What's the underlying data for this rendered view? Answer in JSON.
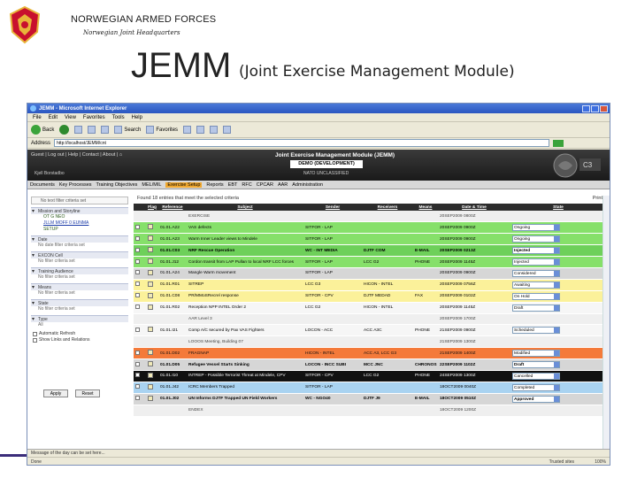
{
  "slide": {
    "org_title": "NORWEGIAN ARMED FORCES",
    "org_sub": "Norwegian Joint Headquarters",
    "title": "JEMM",
    "subtitle": "(Joint Exercise Management Module)"
  },
  "browser": {
    "window_title": "JEMM - Microsoft Internet Explorer",
    "menu": [
      "File",
      "Edit",
      "View",
      "Favorites",
      "Tools",
      "Help"
    ],
    "toolbar": {
      "back": "Back",
      "search": "Search",
      "favorites": "Favorites"
    },
    "address_label": "Address",
    "address": "http://localhost/JEMM/cnt",
    "status_message": "Message of the day can be set here...",
    "status_done": "Done",
    "status_zone": "Trusted sites",
    "zoom": "100%"
  },
  "app": {
    "nav_links": "Guest | Log out | Help | Contact | About | ⌂",
    "name": "Joint Exercise Management Module (JEMM)",
    "environment": "DEMO (DEVELOPMENT)",
    "classification": "NATO UNCLASSIFIED",
    "user": "Kjell Borstadbo",
    "tabs": [
      "Documents",
      "Key Processes",
      "Training Objectives",
      "MEL/MIL",
      "Exercise Setup",
      "Reports",
      "EBT",
      "RFC",
      "CPCAR",
      "AAR",
      "Administration"
    ],
    "active_tab": 4
  },
  "sidebar": {
    "filter_placeholder": "No text filter criteria set",
    "mission_head": "Mission and Storyline",
    "tree_items": [
      "OT G NEO",
      "JLLM MOFF 0 EUNMA",
      "SETUP"
    ],
    "sections": [
      {
        "head": "Date",
        "line": "No date filter criteria set"
      },
      {
        "head": "EXCON Cell",
        "line": "No filter criteria set"
      },
      {
        "head": "Training Audience",
        "line": "No filter criteria set"
      },
      {
        "head": "Means",
        "line": "No filter criteria set"
      },
      {
        "head": "State",
        "line": "No filter criteria set"
      },
      {
        "head": "Type",
        "line": "All"
      }
    ],
    "auto_refresh": "Automatic Refresh",
    "show_links": "Show Links and Relations",
    "apply": "Apply",
    "reset": "Reset"
  },
  "table": {
    "found_text": "Found 18 entries that meet the selected criteria",
    "print": "Print",
    "columns": [
      "Flag",
      "Reference",
      "Subject",
      "Sender",
      "Receivers",
      "Means",
      "Date & Time",
      "State"
    ],
    "rows": [
      {
        "style": "r-plain",
        "ref": "",
        "subject": "EXERCISE",
        "sender": "",
        "receivers": "",
        "means": "",
        "dt": "20SEP2009 0800Z",
        "state": ""
      },
      {
        "style": "r-green",
        "ref": "01.01.A22",
        "subject": "VAS defects",
        "sender": "SITFOR - LAP",
        "receivers": "",
        "means": "",
        "dt": "20SEP2009 0900Z",
        "state": "Ongoing"
      },
      {
        "style": "r-green",
        "ref": "01.01.A23",
        "subject": "Warm Inner Leader views to Mindele",
        "sender": "SITFOR - LAP",
        "receivers": "",
        "means": "",
        "dt": "20SEP2009 0900Z",
        "state": "Ongoing"
      },
      {
        "style": "r-green2 r-bold",
        "ref": "01.01.C03",
        "subject": "NRF Rescue Operation",
        "sender": "WC - INT MEDIA",
        "receivers": "DJTF COM",
        "means": "E-MAIL",
        "dt": "20SEP2009 0213Z",
        "state": "Injected"
      },
      {
        "style": "r-green",
        "ref": "01.01.J12",
        "subject": "Cordon transit from LAP Pullan to local NRF LCC forces",
        "sender": "SITFOR - LAP",
        "receivers": "LCC G2",
        "means": "PHONE",
        "dt": "20SEP2009 1145Z",
        "state": "Injected"
      },
      {
        "style": "r-grey",
        "ref": "01.01.A24",
        "subject": "Mangle Warm movement",
        "sender": "SITFOR - LAP",
        "receivers": "",
        "means": "",
        "dt": "20SEP2009 0900Z",
        "state": "Considered"
      },
      {
        "style": "r-yellow",
        "ref": "01.01.R01",
        "subject": "SITREP",
        "sender": "LCC G3",
        "receivers": "HICON - INTEL",
        "means": "",
        "dt": "20SEP2009 0756Z",
        "state": "Awaiting"
      },
      {
        "style": "r-yellow",
        "ref": "01.01.C08",
        "subject": "PR/MMoSRecrel response",
        "sender": "SITFOR - CPV",
        "receivers": "DJTF MEDAD",
        "means": "FAX",
        "dt": "20SEP2009 0102Z",
        "state": "On Hold"
      },
      {
        "style": "r-white",
        "ref": "01.01.R02",
        "subject": "Reception NPP INTEL Order 2",
        "sender": "LCC G2",
        "receivers": "HICON - INTEL",
        "means": "",
        "dt": "20SEP2009 1145Z",
        "state": "Draft"
      },
      {
        "style": "r-plain",
        "ref": "",
        "subject": "AAR Level 3",
        "sender": "",
        "receivers": "",
        "means": "",
        "dt": "20SEP2009 1700Z",
        "state": ""
      },
      {
        "style": "r-white",
        "ref": "01.01.I21",
        "subject": "Comp A/C secured by Pax VAS Fighters",
        "sender": "LOCON - ACC",
        "receivers": "ACC A3C",
        "means": "PHONE",
        "dt": "21SEP2009 0900Z",
        "state": "Scheduled"
      },
      {
        "style": "r-plain",
        "ref": "",
        "subject": "LOOOS Meeting, Building 07",
        "sender": "",
        "receivers": "",
        "means": "",
        "dt": "21SEP2009 1300Z",
        "state": ""
      },
      {
        "style": "r-orange",
        "ref": "01.01.D02",
        "subject": "FRAGNAP",
        "sender": "HICON - INTEL",
        "receivers": "ACC A3, LCC G3",
        "means": "",
        "dt": "21SEP2009 1400Z",
        "state": "Modified"
      },
      {
        "style": "r-grey r-bold",
        "ref": "01.01.D05",
        "subject": "Refugee Vessel Starts Sinking",
        "sender": "LOCON - INCC SUBI",
        "receivers": "MCC JNC",
        "means": "CHRONOS",
        "dt": "22SEP2009 1102Z",
        "state": "Draft"
      },
      {
        "style": "r-black",
        "ref": "01.01.I10",
        "subject": "INTREP - Possible Terrorist Threat at Mindele, CPV",
        "sender": "SITFOR - CPV",
        "receivers": "LCC G2",
        "means": "PHONE",
        "dt": "24SEP2009 1300Z",
        "state": "Cancelled"
      },
      {
        "style": "r-blue",
        "ref": "01.01.J42",
        "subject": "ICRC Members Trapped",
        "sender": "SITFOR - LAP",
        "receivers": "",
        "means": "",
        "dt": "18OCT2009 0040Z",
        "state": "Completed"
      },
      {
        "style": "r-grey r-bold",
        "ref": "01.01.J02",
        "subject": "UN Informs DJTF Trapped UN Field Workers",
        "sender": "WC - NGO40",
        "receivers": "DJTF J9",
        "means": "E-MAIL",
        "dt": "18OCT2009 0510Z",
        "state": "Approved"
      },
      {
        "style": "r-plain",
        "ref": "",
        "subject": "ENDEX",
        "sender": "",
        "receivers": "",
        "means": "",
        "dt": "18OCT2009 1200Z",
        "state": ""
      }
    ]
  },
  "colors": {
    "header_dark": "#1a1a1a",
    "active_tab": "#f0a830",
    "green": "#86e06a",
    "yellow": "#fbf19a",
    "orange": "#f47a3a",
    "blue": "#a9d3f1",
    "crest_red": "#c8102e"
  }
}
